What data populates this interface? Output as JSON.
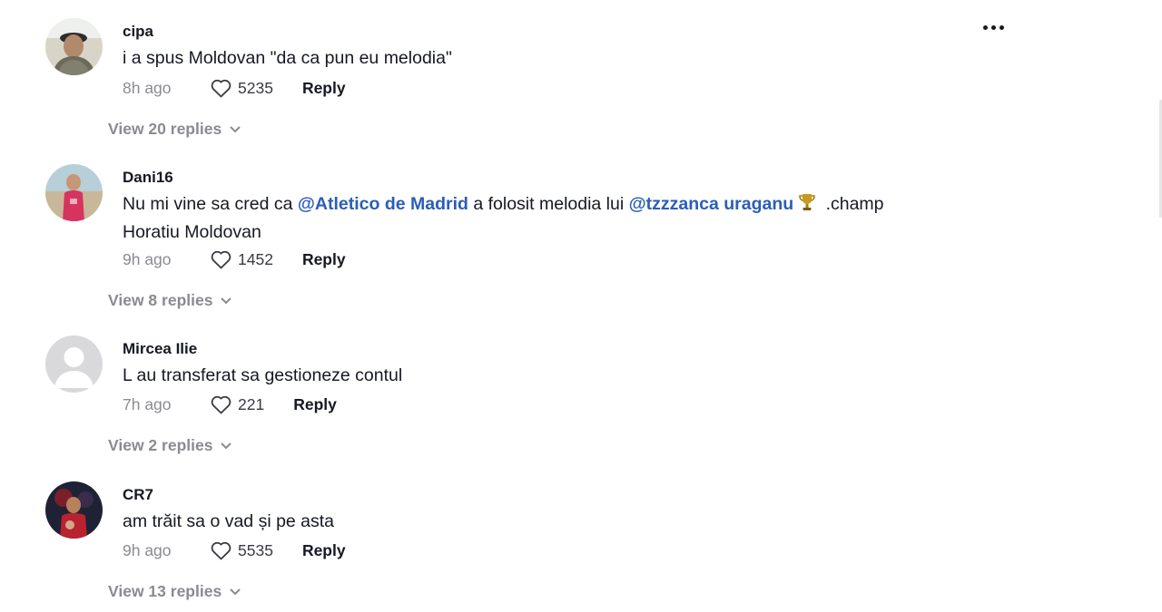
{
  "comments": [
    {
      "username": "cipa",
      "text": "i a spus Moldovan \"da ca pun eu melodia\"",
      "time": "8h ago",
      "likes": "5235",
      "reply_label": "Reply",
      "view_replies": "View 20 replies"
    },
    {
      "username": "Dani16",
      "text_part1": "Nu mi vine sa cred ca ",
      "mention1": "@Atletico de Madrid",
      "text_part2": " a folosit melodia lui ",
      "mention2": "@tzzzanca uraganu",
      "text_part3": " .champ",
      "text_line2": "Horatiu Moldovan",
      "time": "9h ago",
      "likes": "1452",
      "reply_label": "Reply",
      "view_replies": "View 8 replies"
    },
    {
      "username": "Mircea Ilie",
      "text": "L au transferat sa gestioneze contul",
      "time": "7h ago",
      "likes": "221",
      "reply_label": "Reply",
      "view_replies": "View 2 replies"
    },
    {
      "username": "CR7",
      "text": "am trăit sa o vad și pe asta",
      "time": "9h ago",
      "likes": "5535",
      "reply_label": "Reply",
      "view_replies": "View 13 replies"
    }
  ],
  "icons": {
    "like": "heart-outline-icon",
    "more": "more-dots-icon",
    "expand": "chevron-down-icon",
    "emoji": "trophy-emoji-icon"
  },
  "colors": {
    "mention": "#2b5db9",
    "muted": "#8a8b91",
    "text": "#161823"
  }
}
